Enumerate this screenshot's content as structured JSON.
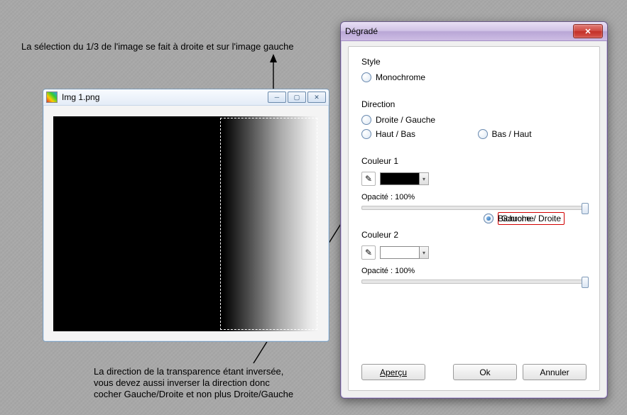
{
  "annotation_top": "La sélection du 1/3 de l'image se fait à droite et sur l'image gauche",
  "annotation_bottom": "La direction de la transparence étant inversée,\nvous devez aussi inverser la direction donc\ncocher Gauche/Droite et non plus Droite/Gauche",
  "image_window": {
    "title": "Img 1.png"
  },
  "dialog": {
    "title": "Dégradé",
    "style": {
      "label": "Style",
      "opt1": "Bichrome",
      "opt2": "Monochrome",
      "selected": "opt1"
    },
    "direction": {
      "label": "Direction",
      "opt1": "Gauche / Droite",
      "opt2": "Droite / Gauche",
      "opt3": "Haut / Bas",
      "opt4": "Bas / Haut",
      "selected": "opt1"
    },
    "color1": {
      "label": "Couleur 1",
      "value": "#000000",
      "opacity_label": "Opacité : 100%"
    },
    "color2": {
      "label": "Couleur 2",
      "value": "#ffffff",
      "opacity_label": "Opacité : 100%"
    },
    "buttons": {
      "preview": "Aperçu",
      "ok": "Ok",
      "cancel": "Annuler"
    }
  }
}
